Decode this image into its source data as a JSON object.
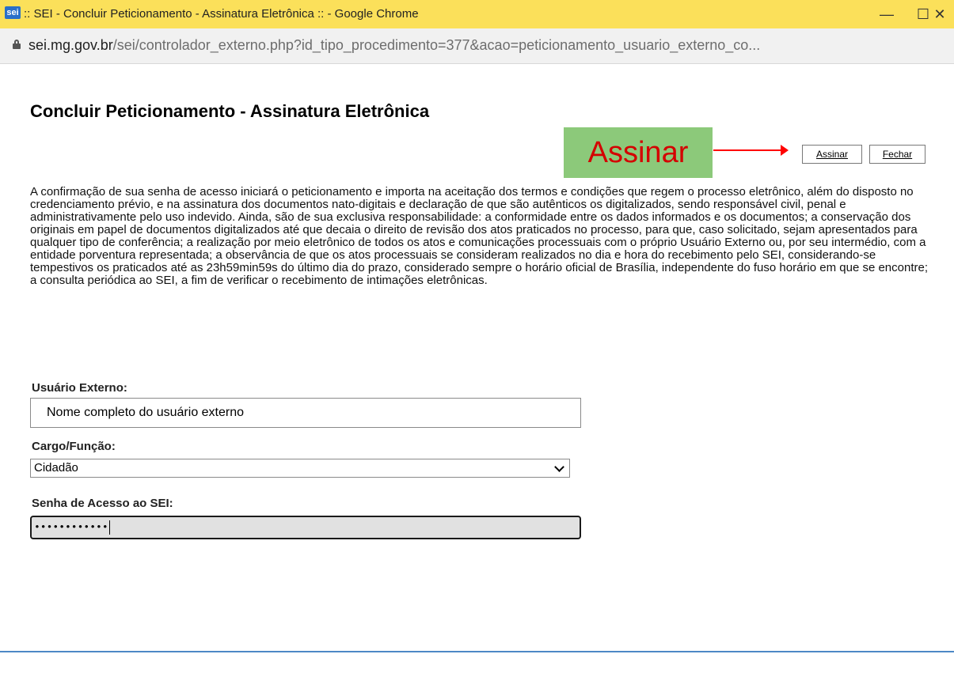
{
  "window": {
    "logo_text": "sei",
    "title": ":: SEI - Concluir Peticionamento - Assinatura Eletrônica :: - Google Chrome",
    "minimize": "—",
    "maximize": "☐",
    "close": "✕"
  },
  "address_bar": {
    "domain": "sei.mg.gov.br",
    "path": "/sei/controlador_externo.php?id_tipo_procedimento=377&acao=peticionamento_usuario_externo_co..."
  },
  "page": {
    "title": "Concluir Peticionamento - Assinatura Eletrônica",
    "callout_label": "Assinar",
    "buttons": {
      "sign": "Assinar",
      "close": "Fechar"
    },
    "terms": "A confirmação de sua senha de acesso iniciará o peticionamento e importa na aceitação dos termos e condições que regem o processo eletrônico, além do disposto no credenciamento prévio, e na assinatura dos documentos nato-digitais e declaração de que são autênticos os digitalizados, sendo responsável civil, penal e administrativamente pelo uso indevido. Ainda, são de sua exclusiva responsabilidade: a conformidade entre os dados informados e os documentos; a conservação dos originais em papel de documentos digitalizados até que decaia o direito de revisão dos atos praticados no processo, para que, caso solicitado, sejam apresentados para qualquer tipo de conferência; a realização por meio eletrônico de todos os atos e comunicações processuais com o próprio Usuário Externo ou, por seu intermédio, com a entidade porventura representada; a observância de que os atos processuais se consideram realizados no dia e hora do recebimento pelo SEI, considerando-se tempestivos os praticados até as 23h59min59s do último dia do prazo, considerado sempre o horário oficial de Brasília, independente do fuso horário em que se encontre; a consulta periódica ao SEI, a fim de verificar o recebimento de intimações eletrônicas.",
    "user_label": "Usuário Externo:",
    "user_value": "Nome completo do usuário externo",
    "role_label": "Cargo/Função:",
    "role_value": "Cidadão",
    "password_label": "Senha de Acesso ao SEI:",
    "password_value": "••••••••••••"
  },
  "colors": {
    "titlebar": "#fbe05a",
    "callout_bg": "#8cc97a",
    "callout_text": "#d40000",
    "arrow": "#ff0000"
  }
}
